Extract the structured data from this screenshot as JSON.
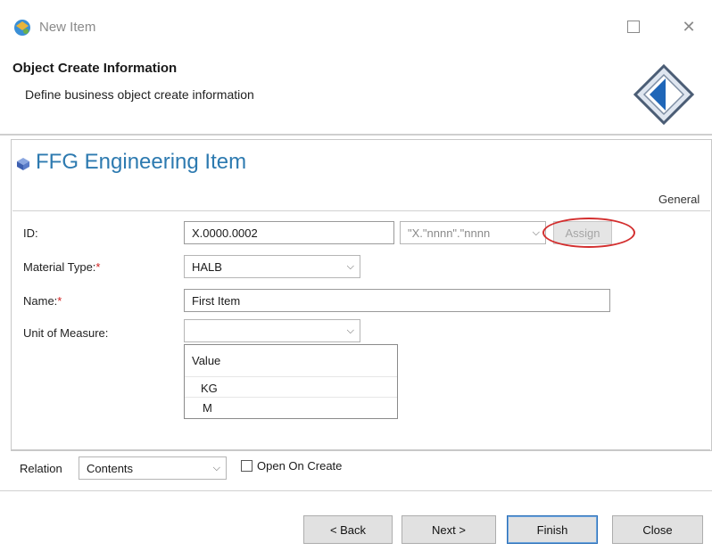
{
  "window": {
    "title": "New Item",
    "app_icon": "app-logo-icon",
    "maximize_icon": "maximize-icon",
    "close_icon": "close-icon",
    "close_glyph": "✕"
  },
  "header": {
    "title": "Object Create Information",
    "subtitle": "Define business object create information",
    "graphic_icon": "diamond-arrow-icon"
  },
  "form": {
    "title": "FFG Engineering Item",
    "title_color": "#2d7ab0",
    "icon": "cube-icon",
    "tab": "General",
    "fields": {
      "id": {
        "label": "ID:",
        "value": "X.0000.0002",
        "pattern": "\"X.\"nnnn\".\"nnnn",
        "assign_label": "Assign"
      },
      "material_type": {
        "label": "Material Type:",
        "required_mark": "*",
        "value": "HALB"
      },
      "name": {
        "label": "Name:",
        "required_mark": "*",
        "value": "First Item"
      },
      "unit_of_measure": {
        "label": "Unit of Measure:",
        "value": "",
        "dropdown": {
          "header": "Value",
          "options": [
            "KG",
            "M"
          ]
        }
      }
    }
  },
  "relation": {
    "label": "Relation",
    "value": "Contents",
    "open_on_create_label": "Open On Create",
    "open_on_create_checked": false
  },
  "buttons": {
    "back": "< Back",
    "next": "Next >",
    "finish": "Finish",
    "close": "Close"
  },
  "colors": {
    "required": "#d02020",
    "highlight_ring": "#d32f2f",
    "finish_border": "#2a6fb8"
  }
}
